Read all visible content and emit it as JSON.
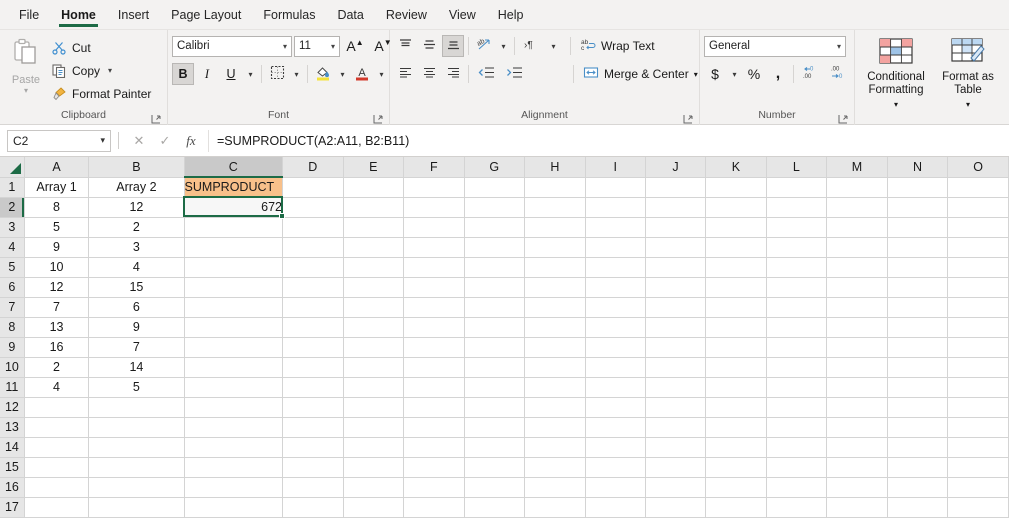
{
  "ribbon": {
    "tabs": [
      {
        "label": "File",
        "active": false
      },
      {
        "label": "Home",
        "active": true
      },
      {
        "label": "Insert",
        "active": false
      },
      {
        "label": "Page Layout",
        "active": false
      },
      {
        "label": "Formulas",
        "active": false
      },
      {
        "label": "Data",
        "active": false
      },
      {
        "label": "Review",
        "active": false
      },
      {
        "label": "View",
        "active": false
      },
      {
        "label": "Help",
        "active": false
      }
    ],
    "accent_color": "#1d6b46",
    "clipboard": {
      "label": "Clipboard",
      "paste_label": "Paste",
      "cut_label": "Cut",
      "copy_label": "Copy",
      "format_painter_label": "Format Painter"
    },
    "font": {
      "label": "Font",
      "font_name": "Calibri",
      "font_size": "11",
      "bold_label": "B",
      "italic_label": "I",
      "underline_label": "U",
      "grow_font_label": "A",
      "shrink_font_label": "A"
    },
    "alignment": {
      "label": "Alignment",
      "wrap_text_label": "Wrap Text",
      "merge_center_label": "Merge & Center"
    },
    "number": {
      "label": "Number",
      "format": "General",
      "currency_label": "$",
      "percent_label": "%",
      "comma_label": ","
    },
    "styles": {
      "conditional_formatting_label": "Conditional Formatting",
      "format_as_table_label": "Format as Table"
    }
  },
  "formula_bar": {
    "name_box": "C2",
    "formula": "=SUMPRODUCT(A2:A11, B2:B11)"
  },
  "sheet": {
    "columns": [
      "A",
      "B",
      "C",
      "D",
      "E",
      "F",
      "G",
      "H",
      "I",
      "J",
      "K",
      "L",
      "M",
      "N",
      "O"
    ],
    "selected_column": "C",
    "selected_row": 2,
    "rows": [
      1,
      2,
      3,
      4,
      5,
      6,
      7,
      8,
      9,
      10,
      11,
      12,
      13,
      14,
      15,
      16,
      17
    ],
    "headers": {
      "a1": "Array 1",
      "b1": "Array 2",
      "c1": "SUMPRODUCT"
    },
    "header_fill_color": "#f8c08a",
    "result_text_color": "#e08a2e",
    "array1": [
      8,
      5,
      9,
      10,
      12,
      7,
      13,
      16,
      2,
      4
    ],
    "array2": [
      12,
      2,
      3,
      4,
      15,
      6,
      9,
      7,
      14,
      5
    ],
    "result": "672"
  }
}
